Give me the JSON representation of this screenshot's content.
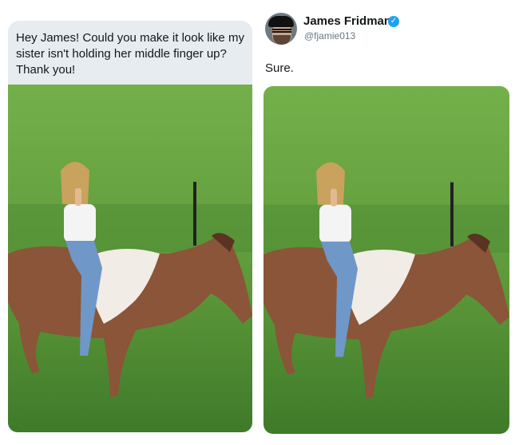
{
  "request": {
    "text": "Hey James! Could you make it look like my sister isn't holding her middle finger up? Thank you!"
  },
  "reply": {
    "author_name": "James Fridman",
    "author_handle": "@fjamie013",
    "verified_icon": "verified-badge-icon",
    "text": "Sure."
  },
  "colors": {
    "bubble": "#e6ecf0",
    "verified": "#1da1f2",
    "handle": "#657786"
  }
}
